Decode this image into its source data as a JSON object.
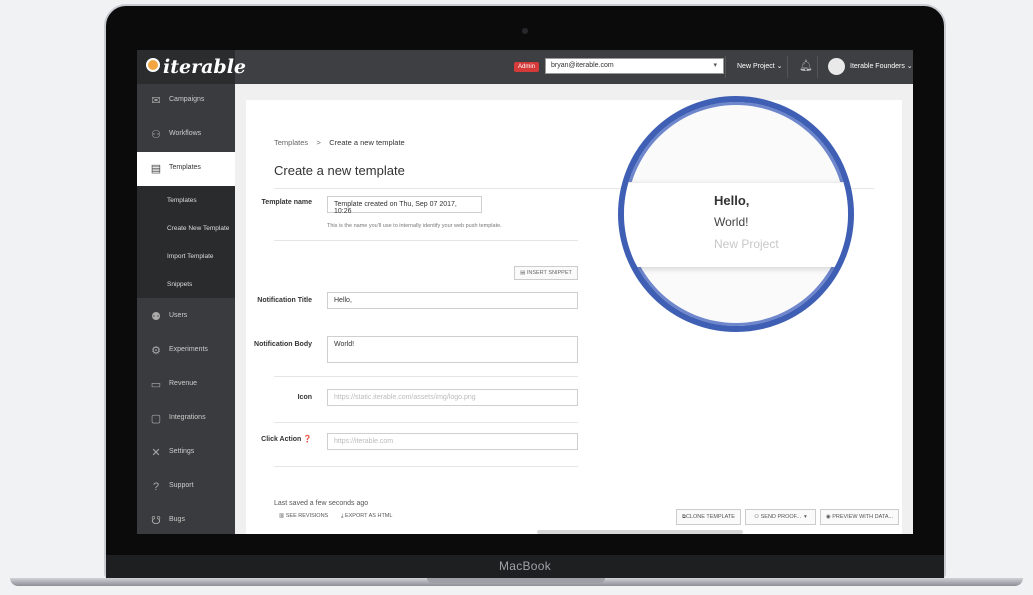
{
  "device": {
    "label": "MacBook"
  },
  "topbar": {
    "logo_text": "iterable",
    "admin_badge": "Admin",
    "project_value": "bryan@iterable.com",
    "new_project": "New Project ⌄",
    "user_name": "Iterable Founders ⌄"
  },
  "sidebar": {
    "items": [
      {
        "label": "Campaigns",
        "icon": "envelope-icon"
      },
      {
        "label": "Workflows",
        "icon": "workflow-icon"
      },
      {
        "label": "Templates",
        "icon": "template-icon"
      },
      {
        "label": "Users",
        "icon": "users-icon"
      },
      {
        "label": "Experiments",
        "icon": "experiments-icon"
      },
      {
        "label": "Revenue",
        "icon": "revenue-icon"
      },
      {
        "label": "Integrations",
        "icon": "integrations-icon"
      },
      {
        "label": "Settings",
        "icon": "settings-icon"
      },
      {
        "label": "Support",
        "icon": "support-icon"
      },
      {
        "label": "Bugs",
        "icon": "bug-icon"
      }
    ],
    "sub_items": [
      "Templates",
      "Create New Template",
      "Import Template",
      "Snippets"
    ]
  },
  "breadcrumb": {
    "root": "Templates",
    "separator": ">",
    "current": "Create a new template"
  },
  "page_title": "Create a new template",
  "form": {
    "template_name_label": "Template name",
    "template_name_value": "Template created on Thu, Sep 07 2017, 10:26",
    "template_name_help": "This is the name you'll use to internally identify your web push template.",
    "insert_snippet": "INSERT SNIPPET",
    "title_label": "Notification Title",
    "title_value": "Hello,",
    "body_label": "Notification Body",
    "body_value": "World!",
    "icon_label": "Icon",
    "icon_placeholder": "https://static.iterable.com/assets/img/logo.png",
    "click_label": "Click Action ❓",
    "click_placeholder": "https://iterable.com"
  },
  "footer": {
    "saved": "Last saved a few seconds ago",
    "see_revisions": "SEE REVISIONS",
    "export_html": "EXPORT AS HTML",
    "clone": "CLONE TEMPLATE",
    "send_proof": "SEND PROOF...",
    "preview": "PREVIEW WITH DATA..."
  },
  "preview": {
    "title": "Hello,",
    "body": "World!",
    "project": "New Project"
  },
  "colors": {
    "accent_ring": "#3f5fb4",
    "admin_badge": "#d43a3a",
    "logo_mark": "#f2a540"
  }
}
